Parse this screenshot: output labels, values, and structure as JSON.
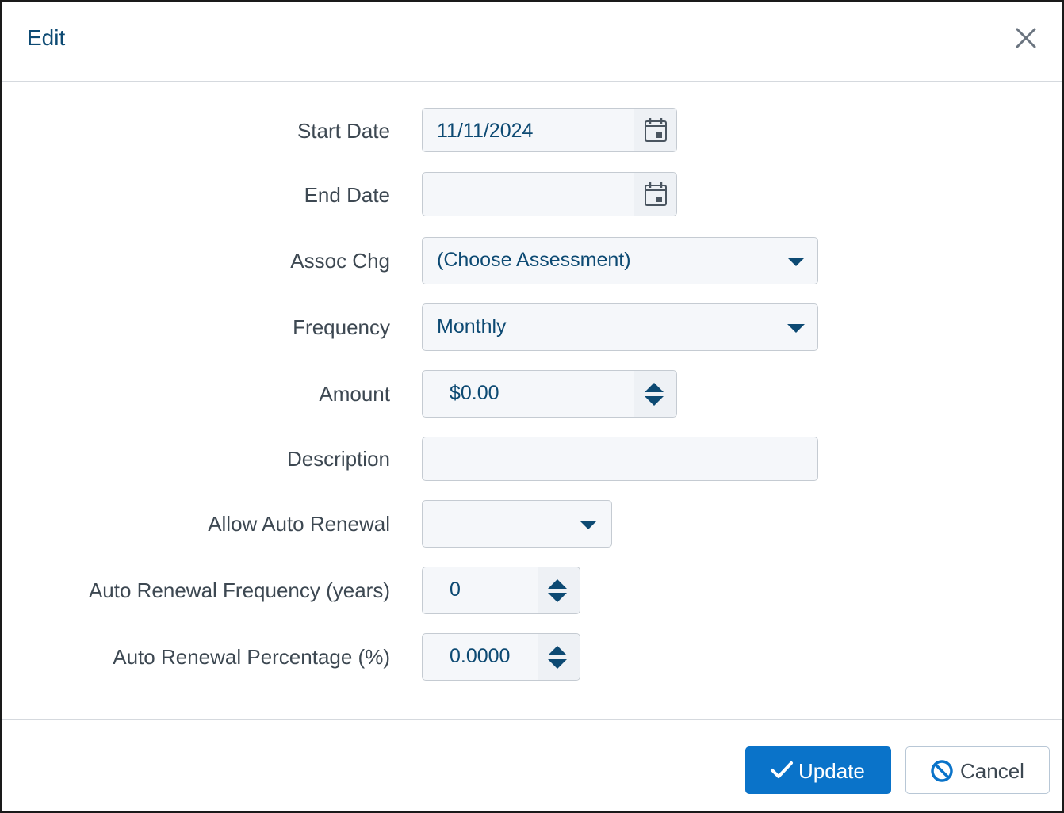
{
  "dialog": {
    "title": "Edit",
    "close_icon": "close-icon"
  },
  "form": {
    "start_date": {
      "label": "Start Date",
      "value": "11/11/2024",
      "icon": "calendar-icon"
    },
    "end_date": {
      "label": "End Date",
      "value": "",
      "icon": "calendar-icon"
    },
    "assoc_chg": {
      "label": "Assoc Chg",
      "value": "(Choose Assessment)",
      "icon": "caret-down-icon"
    },
    "frequency": {
      "label": "Frequency",
      "value": "Monthly",
      "icon": "caret-down-icon"
    },
    "amount": {
      "label": "Amount",
      "value": "$0.00",
      "icon": "spinner-icon"
    },
    "description": {
      "label": "Description",
      "value": ""
    },
    "allow_auto_renewal": {
      "label": "Allow Auto Renewal",
      "value": "",
      "icon": "caret-down-icon"
    },
    "auto_renewal_frequency": {
      "label": "Auto Renewal Frequency (years)",
      "value": "0",
      "icon": "spinner-icon"
    },
    "auto_renewal_percentage": {
      "label": "Auto Renewal Percentage (%)",
      "value": "0.0000",
      "icon": "spinner-icon"
    }
  },
  "footer": {
    "update_label": "Update",
    "update_icon": "checkmark-icon",
    "cancel_label": "Cancel",
    "cancel_icon": "ban-icon"
  },
  "colors": {
    "accent": "#0a73c9",
    "text_dark_blue": "#0d4a73",
    "label_gray": "#3d4852"
  }
}
